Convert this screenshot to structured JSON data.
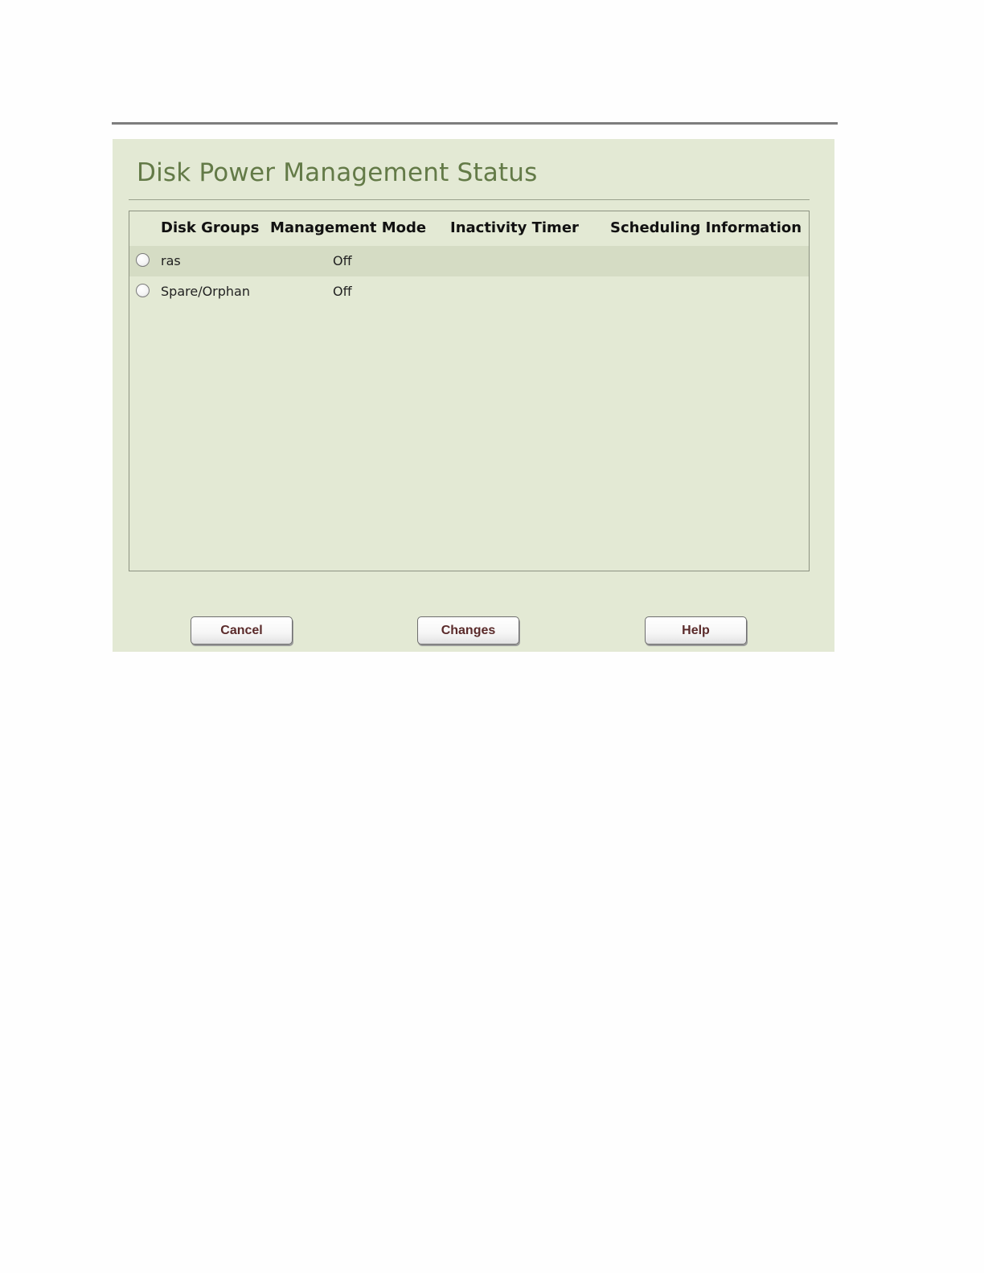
{
  "panel": {
    "title": "Disk Power Management Status"
  },
  "table": {
    "headers": {
      "disk_groups": "Disk Groups",
      "management_mode": "Management Mode",
      "inactivity_timer": "Inactivity Timer",
      "scheduling_information": "Scheduling Information"
    },
    "rows": [
      {
        "disk_group": "ras",
        "management_mode": "Off",
        "inactivity_timer": "",
        "scheduling_information": "",
        "selected": false
      },
      {
        "disk_group": "Spare/Orphan",
        "management_mode": "Off",
        "inactivity_timer": "",
        "scheduling_information": "",
        "selected": false
      }
    ]
  },
  "buttons": {
    "cancel": "Cancel",
    "changes": "Changes",
    "help": "Help"
  },
  "colors": {
    "panel_background": "#e3e9d4",
    "title_text": "#637a47",
    "alt_row": "#d5dcc4",
    "button_text": "#5a2a2a"
  }
}
